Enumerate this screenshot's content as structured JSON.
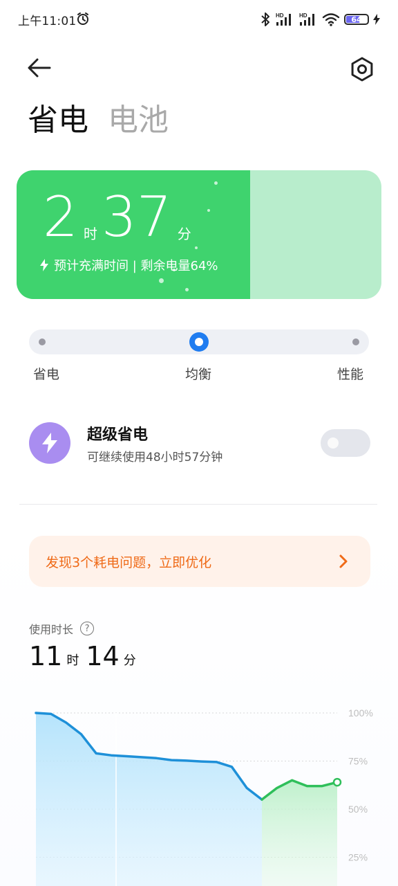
{
  "status_bar": {
    "time": "上午11:01",
    "battery_level": "64",
    "battery_fill_fraction": 0.64
  },
  "header": {
    "tabs": [
      {
        "label": "省电",
        "active": true
      },
      {
        "label": "电池",
        "active": false
      }
    ]
  },
  "charge_card": {
    "hours": "2",
    "hours_unit": "时",
    "minutes": "37",
    "minutes_unit": "分",
    "subtitle": "预计充满时间 | 剩余电量64%",
    "charge_fraction": 0.64,
    "fill_color": "#3fd36e",
    "remainder_color": "#b8edcc"
  },
  "mode_slider": {
    "options": [
      "省电",
      "均衡",
      "性能"
    ],
    "selected_index": 1,
    "accent": "#1f7cf0"
  },
  "ultra_save": {
    "title": "超级省电",
    "subtitle": "可继续使用48小时57分钟",
    "enabled": false,
    "icon": "lightning-icon",
    "icon_bg": "#a98df0"
  },
  "optimize_banner": {
    "text": "发现3个耗电问题，立即优化",
    "color": "#ef6a17"
  },
  "usage": {
    "label": "使用时长",
    "hours": "11",
    "hours_unit": "时",
    "minutes": "14",
    "minutes_unit": "分"
  },
  "chart_data": {
    "type": "line",
    "y_ticks": [
      "100%",
      "75%",
      "50%",
      "25%"
    ],
    "ylim": [
      0,
      100
    ],
    "discharge_series": {
      "color": "#1e90d8",
      "values": [
        100,
        99.5,
        95,
        89,
        79,
        78,
        77.5,
        77,
        76.5,
        75.5,
        75.2,
        74.8,
        74.5,
        72,
        61,
        55
      ]
    },
    "charge_series": {
      "color": "#2fbf5a",
      "values": [
        55,
        61,
        65,
        62,
        62,
        64
      ]
    },
    "grid": true
  }
}
